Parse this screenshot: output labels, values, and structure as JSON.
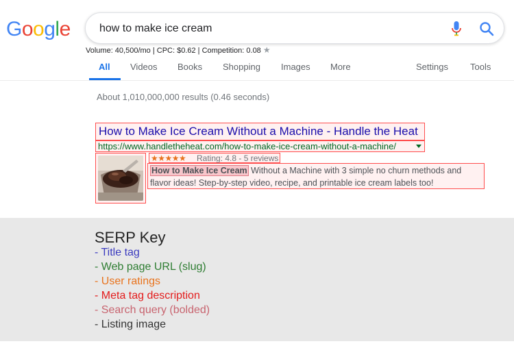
{
  "logo": {
    "letters": [
      "G",
      "o",
      "o",
      "g",
      "l",
      "e"
    ],
    "colors": [
      "#4285f4",
      "#ea4335",
      "#fbbc05",
      "#4285f4",
      "#34a853",
      "#ea4335"
    ]
  },
  "search": {
    "query": "how to make ice cream"
  },
  "keyword_stats": {
    "text": "Volume: 40,500/mo | CPC: $0.62 | Competition: 0.08",
    "star": "★"
  },
  "tabs": [
    {
      "label": "All",
      "active": true
    },
    {
      "label": "Videos"
    },
    {
      "label": "Books"
    },
    {
      "label": "Shopping"
    },
    {
      "label": "Images"
    },
    {
      "label": "More"
    },
    {
      "label": "Settings"
    },
    {
      "label": "Tools"
    }
  ],
  "results_stats": "About 1,010,000,000 results (0.46 seconds)",
  "result": {
    "title": "How to Make Ice Cream Without a Machine - Handle the Heat",
    "url": "https://www.handletheheat.com/how-to-make-ice-cream-without-a-machine/",
    "stars": "★★★★★",
    "rating_text": "Rating: 4.8 - 5 reviews",
    "desc_bold": "How to Make Ice Cream",
    "desc_rest": " Without a Machine with 3 simple no churn methods and flavor ideas! Step-by-step video, recipe, and printable ice cream labels too!"
  },
  "serp_key": {
    "title": "SERP Key",
    "items": [
      {
        "label": "- Title tag",
        "color": "#3b3bbf"
      },
      {
        "label": "- Web page URL (slug)",
        "color": "#2e7d32"
      },
      {
        "label": "- User ratings",
        "color": "#e8731d"
      },
      {
        "label": "- Meta tag description",
        "color": "#e31b1b"
      },
      {
        "label": "- Search query (bolded)",
        "color": "#c8646f"
      },
      {
        "label": "- Listing image",
        "color": "#333333"
      }
    ]
  },
  "colors": {
    "accent": "#1a73e8",
    "link": "#1a0dab",
    "url": "#006621",
    "highlight": "#ff4c4c"
  }
}
